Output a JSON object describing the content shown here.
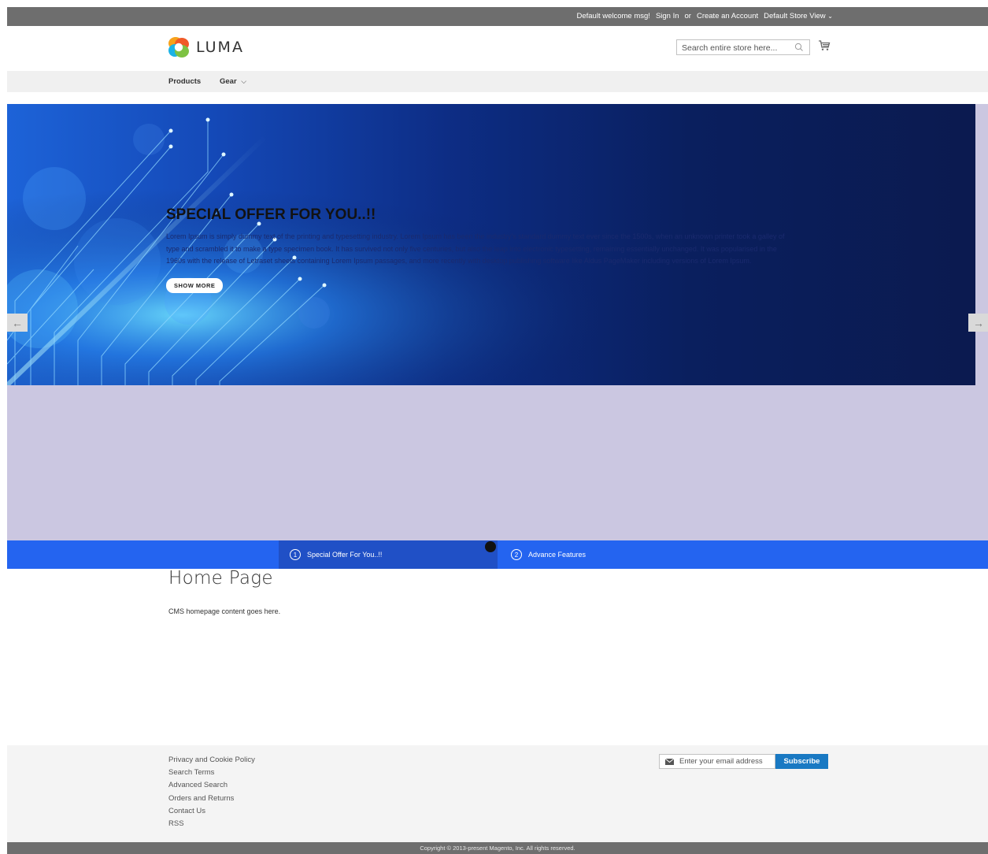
{
  "topbar": {
    "welcome": "Default welcome msg!",
    "sign_in": "Sign In",
    "or": "or",
    "create_account": "Create an Account",
    "store_view": "Default Store View"
  },
  "header": {
    "logo_text": "LUMA",
    "search_placeholder": "Search entire store here...",
    "search_icon": "search-icon",
    "cart_icon": "cart-icon"
  },
  "nav": {
    "items": [
      {
        "label": "Products"
      },
      {
        "label": "Gear",
        "icon": "chevron-down-icon"
      }
    ]
  },
  "slider": {
    "title": "SPECIAL OFFER FOR YOU..!!",
    "text": "Lorem Ipsum is simply dummy text of the printing and typesetting industry. Lorem Ipsum has been the industry's standard dummy text ever since the 1500s, when an unknown printer took a galley of type and scrambled it to make a type specimen book. It has survived not only five centuries, but also the leap into electronic typesetting, remaining essentially unchanged. It was popularised in the 1960s with the release of Letraset sheets containing Lorem Ipsum passages, and more recently with desktop publishing software like Aldus PageMaker including versions of Lorem Ipsum.",
    "button": "SHOW MORE",
    "prev_arrow": "←",
    "next_arrow": "→",
    "tabs": [
      {
        "num": "1",
        "label": "Special Offer For You..!!"
      },
      {
        "num": "2",
        "label": "Advance Features"
      }
    ]
  },
  "main": {
    "title": "Home Page",
    "content": "CMS homepage content goes here."
  },
  "footer": {
    "links": [
      "Privacy and Cookie Policy",
      "Search Terms",
      "Advanced Search",
      "Orders and Returns",
      "Contact Us",
      "RSS"
    ],
    "newsletter_placeholder": "Enter your email address",
    "newsletter_icon": "envelope-icon",
    "subscribe": "Subscribe",
    "copyright": "Copyright © 2013-present Magento, Inc. All rights reserved."
  },
  "colors": {
    "topbar": "#6e6e6e",
    "accent": "#1979c3",
    "tab_bar": "#2464f0",
    "slider_bg": "#cbc7e1"
  }
}
